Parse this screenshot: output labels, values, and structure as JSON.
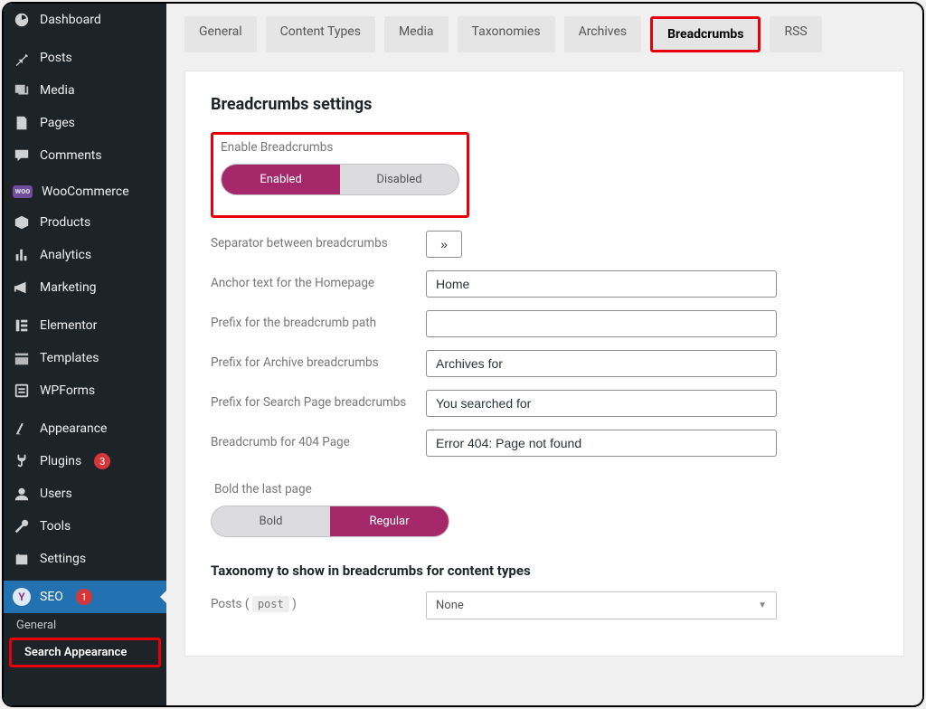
{
  "sidebar": {
    "items": [
      {
        "label": "Dashboard",
        "icon": "dashboard"
      },
      {
        "label": "Posts",
        "icon": "posts"
      },
      {
        "label": "Media",
        "icon": "media"
      },
      {
        "label": "Pages",
        "icon": "pages"
      },
      {
        "label": "Comments",
        "icon": "comments"
      },
      {
        "label": "WooCommerce",
        "icon": "woo"
      },
      {
        "label": "Products",
        "icon": "products"
      },
      {
        "label": "Analytics",
        "icon": "analytics"
      },
      {
        "label": "Marketing",
        "icon": "marketing"
      },
      {
        "label": "Elementor",
        "icon": "elementor"
      },
      {
        "label": "Templates",
        "icon": "templates"
      },
      {
        "label": "WPForms",
        "icon": "wpforms"
      },
      {
        "label": "Appearance",
        "icon": "appearance"
      },
      {
        "label": "Plugins",
        "icon": "plugins",
        "badge": "3"
      },
      {
        "label": "Users",
        "icon": "users"
      },
      {
        "label": "Tools",
        "icon": "tools"
      },
      {
        "label": "Settings",
        "icon": "settings"
      },
      {
        "label": "SEO",
        "icon": "seo",
        "badge": "1",
        "active": true
      }
    ],
    "sub": [
      {
        "label": "General"
      },
      {
        "label": "Search Appearance",
        "current": true
      }
    ]
  },
  "tabs": [
    {
      "label": "General"
    },
    {
      "label": "Content Types"
    },
    {
      "label": "Media"
    },
    {
      "label": "Taxonomies"
    },
    {
      "label": "Archives"
    },
    {
      "label": "Breadcrumbs",
      "active": true
    },
    {
      "label": "RSS"
    }
  ],
  "panel": {
    "heading": "Breadcrumbs settings",
    "enable": {
      "label": "Enable Breadcrumbs",
      "on": "Enabled",
      "off": "Disabled"
    },
    "fields": {
      "separator": {
        "label": "Separator between breadcrumbs",
        "value": "»"
      },
      "anchor": {
        "label": "Anchor text for the Homepage",
        "value": "Home"
      },
      "prefix_path": {
        "label": "Prefix for the breadcrumb path",
        "value": ""
      },
      "prefix_archive": {
        "label": "Prefix for Archive breadcrumbs",
        "value": "Archives for"
      },
      "prefix_search": {
        "label": "Prefix for Search Page breadcrumbs",
        "value": "You searched for"
      },
      "bc_404": {
        "label": "Breadcrumb for 404 Page",
        "value": "Error 404: Page not found"
      }
    },
    "bold": {
      "label": "Bold the last page",
      "on": "Bold",
      "off": "Regular"
    },
    "taxonomy": {
      "heading": "Taxonomy to show in breadcrumbs for content types",
      "posts_label": "Posts",
      "posts_code": "post",
      "select_value": "None"
    }
  }
}
